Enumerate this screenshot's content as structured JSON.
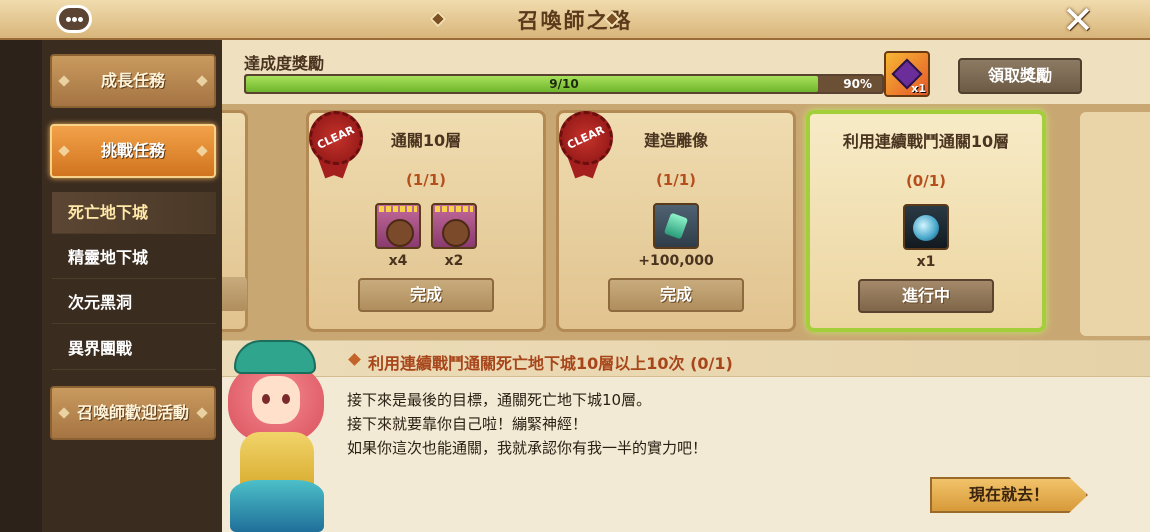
{
  "header": {
    "title": "召喚師之路"
  },
  "sidebar": {
    "categories": [
      {
        "label": "成長任務"
      },
      {
        "label": "挑戰任務"
      },
      {
        "label": "召喚師歡迎活動"
      }
    ],
    "sub_items": [
      {
        "label": "死亡地下城"
      },
      {
        "label": "精靈地下城"
      },
      {
        "label": "次元黑洞"
      },
      {
        "label": "異界團戰"
      }
    ]
  },
  "progress": {
    "label": "達成度獎勵",
    "text": "9/10",
    "percent_text": "90%",
    "fraction": 0.9,
    "reward_qty": "x1",
    "claim_label": "領取獎勵"
  },
  "cards": [
    {
      "title": "通關10層",
      "count": "(1/1)",
      "clear_text": "CLEAR",
      "items": [
        {
          "icon": "rune-icon",
          "qty": "x4"
        },
        {
          "icon": "rune-icon",
          "qty": "x2"
        }
      ],
      "button": "完成"
    },
    {
      "title": "建造雕像",
      "count": "(1/1)",
      "clear_text": "CLEAR",
      "items": [
        {
          "icon": "crystal-icon",
          "qty": "+100,000"
        }
      ],
      "button": "完成"
    },
    {
      "title": "利用連續戰鬥通關10層",
      "count": "(0/1)",
      "items": [
        {
          "icon": "orb-icon",
          "qty": "x1"
        }
      ],
      "button": "進行中"
    }
  ],
  "description": {
    "title": "利用連續戰鬥通關死亡地下城10層以上10次 (0/1)",
    "lines": [
      "接下來是最後的目標，通關死亡地下城10層。",
      "接下來就要靠你自己啦！繃緊神經！",
      "如果你這次也能通關，我就承認你有我一半的實力吧！"
    ],
    "go_label": "現在就去！"
  },
  "colors": {
    "accent_orange": "#d1741f",
    "progress_green": "#6fb62c",
    "current_card_border": "#a3cf3b",
    "clear_red": "#a51f1f"
  }
}
